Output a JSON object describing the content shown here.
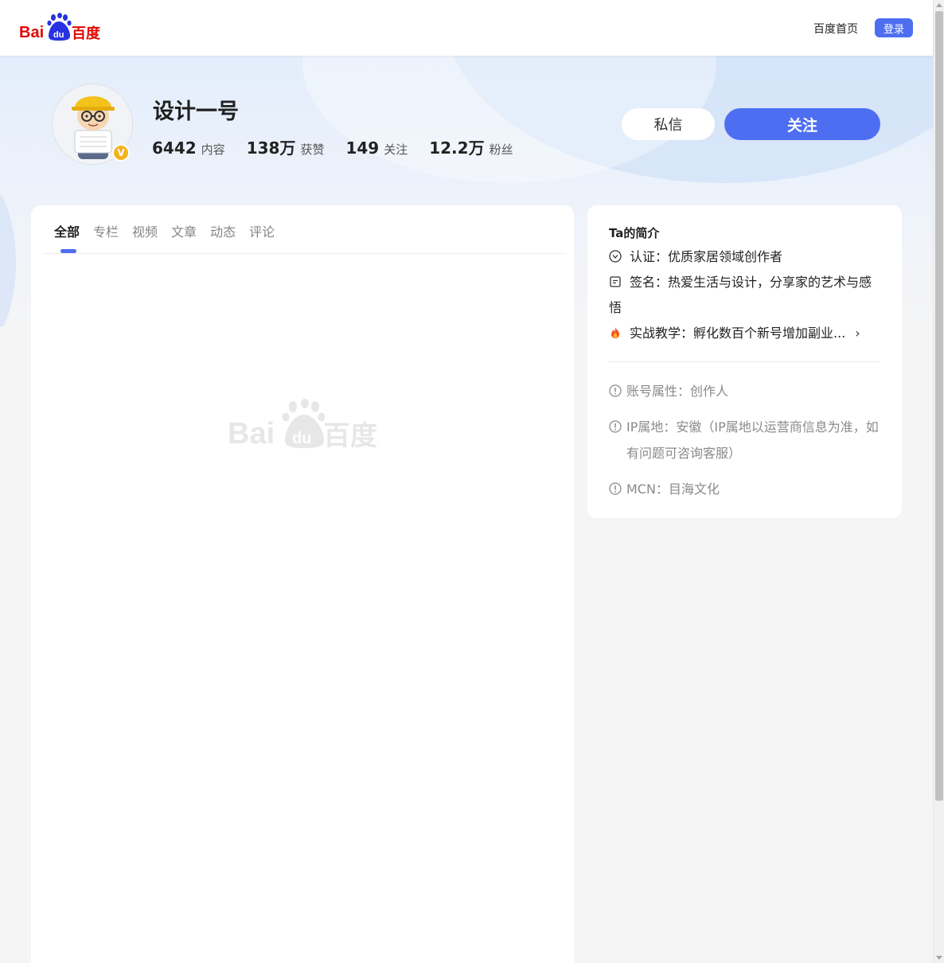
{
  "header": {
    "nav_home": "百度首页",
    "login": "登录"
  },
  "logo": {
    "text_bai": "Bai",
    "text_du": "du",
    "text_cn": "百度"
  },
  "profile": {
    "name": "设计一号",
    "badge": "V",
    "stats": [
      {
        "num": "6442",
        "label": "内容"
      },
      {
        "num": "138万",
        "label": "获赞"
      },
      {
        "num": "149",
        "label": "关注"
      },
      {
        "num": "12.2万",
        "label": "粉丝"
      }
    ],
    "message_button": "私信",
    "follow_button": "关注"
  },
  "tabs": [
    "全部",
    "专栏",
    "视频",
    "文章",
    "动态",
    "评论"
  ],
  "active_tab": "全部",
  "about": {
    "title": "Ta的简介",
    "certification_label": "认证：",
    "certification": "优质家居领域创作者",
    "signature_label": "签名：",
    "signature": "热爱生活与设计，分享家的艺术与感悟",
    "promo": "实战教学：孵化数百个新号增加副业...",
    "account_type_label": "账号属性：",
    "account_type": "创作人",
    "ip_label": "IP属地：",
    "ip": "安徽（IP属地以运营商信息为准，如有问题可咨询客服）",
    "mcn_label": "MCN：",
    "mcn": "目海文化"
  },
  "colors": {
    "accent": "#4e6ef2",
    "logo_red": "#e10602",
    "logo_blue": "#2932e1",
    "badge_gold": "#f5b21f"
  }
}
